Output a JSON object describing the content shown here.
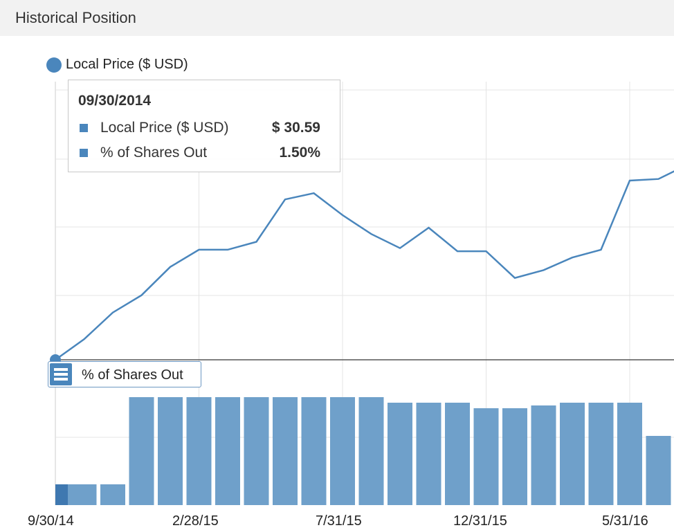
{
  "header": {
    "title": "Historical Position"
  },
  "colors": {
    "series": "#4a86bc",
    "bar": "#6fa0ca",
    "bar_selected": "#3f78b0",
    "grid": "#e4e4e4",
    "divider": "#555555"
  },
  "tooltip": {
    "date": "09/30/2014",
    "rows": [
      {
        "name": "Local Price ($ USD)",
        "value": "$ 30.59"
      },
      {
        "name": "% of Shares Out",
        "value": "1.50%"
      }
    ]
  },
  "legend": {
    "label": "Local Price ($ USD)",
    "icon": "circle-marker"
  },
  "shares_panel": {
    "label": "% of Shares Out",
    "icon": "hamburger-menu-icon"
  },
  "chart_data": [
    {
      "type": "line",
      "series": [
        {
          "name": "Local Price ($ USD)",
          "x": [
            "9/30/14",
            "10/31/14",
            "11/30/14",
            "12/31/14",
            "1/31/15",
            "2/28/15",
            "3/31/15",
            "4/30/15",
            "5/31/15",
            "6/30/15",
            "7/31/15",
            "8/31/15",
            "9/30/15",
            "10/31/15",
            "11/30/15",
            "12/31/15",
            "1/31/16",
            "2/29/16",
            "3/31/16",
            "4/30/16",
            "5/31/16",
            "6/30/16",
            "7/31/16"
          ],
          "values": [
            30.59,
            31.9,
            33.6,
            34.7,
            36.5,
            37.6,
            37.6,
            38.1,
            40.8,
            41.2,
            39.8,
            38.6,
            37.7,
            39.0,
            37.5,
            37.5,
            35.8,
            36.3,
            37.1,
            37.6,
            42.0,
            42.1,
            43.0
          ]
        }
      ],
      "ylim": [
        30.59,
        48.3
      ],
      "grid": true,
      "legend_position": "top-left"
    },
    {
      "type": "bar",
      "series": [
        {
          "name": "% of Shares Out",
          "categories": [
            "9/30/14",
            "10/31/14",
            "11/30/14",
            "12/31/14",
            "1/31/15",
            "2/28/15",
            "3/31/15",
            "4/30/15",
            "5/31/15",
            "6/30/15",
            "7/31/15",
            "8/31/15",
            "9/30/15",
            "10/31/15",
            "11/30/15",
            "12/31/15",
            "1/31/16",
            "2/29/16",
            "3/31/16",
            "4/30/16",
            "5/31/16",
            "6/30/16",
            "7/31/16"
          ],
          "values": [
            1.5,
            1.5,
            1.5,
            7.8,
            7.8,
            7.8,
            7.8,
            7.8,
            7.8,
            7.8,
            7.8,
            7.8,
            7.4,
            7.4,
            7.4,
            7.0,
            7.0,
            7.2,
            7.4,
            7.4,
            7.4,
            5.0,
            5.0
          ]
        }
      ],
      "ylim": [
        0,
        10
      ],
      "grid": true
    }
  ],
  "x_tick_labels": [
    "9/30/14",
    "2/28/15",
    "7/31/15",
    "12/31/15",
    "5/31/16"
  ]
}
